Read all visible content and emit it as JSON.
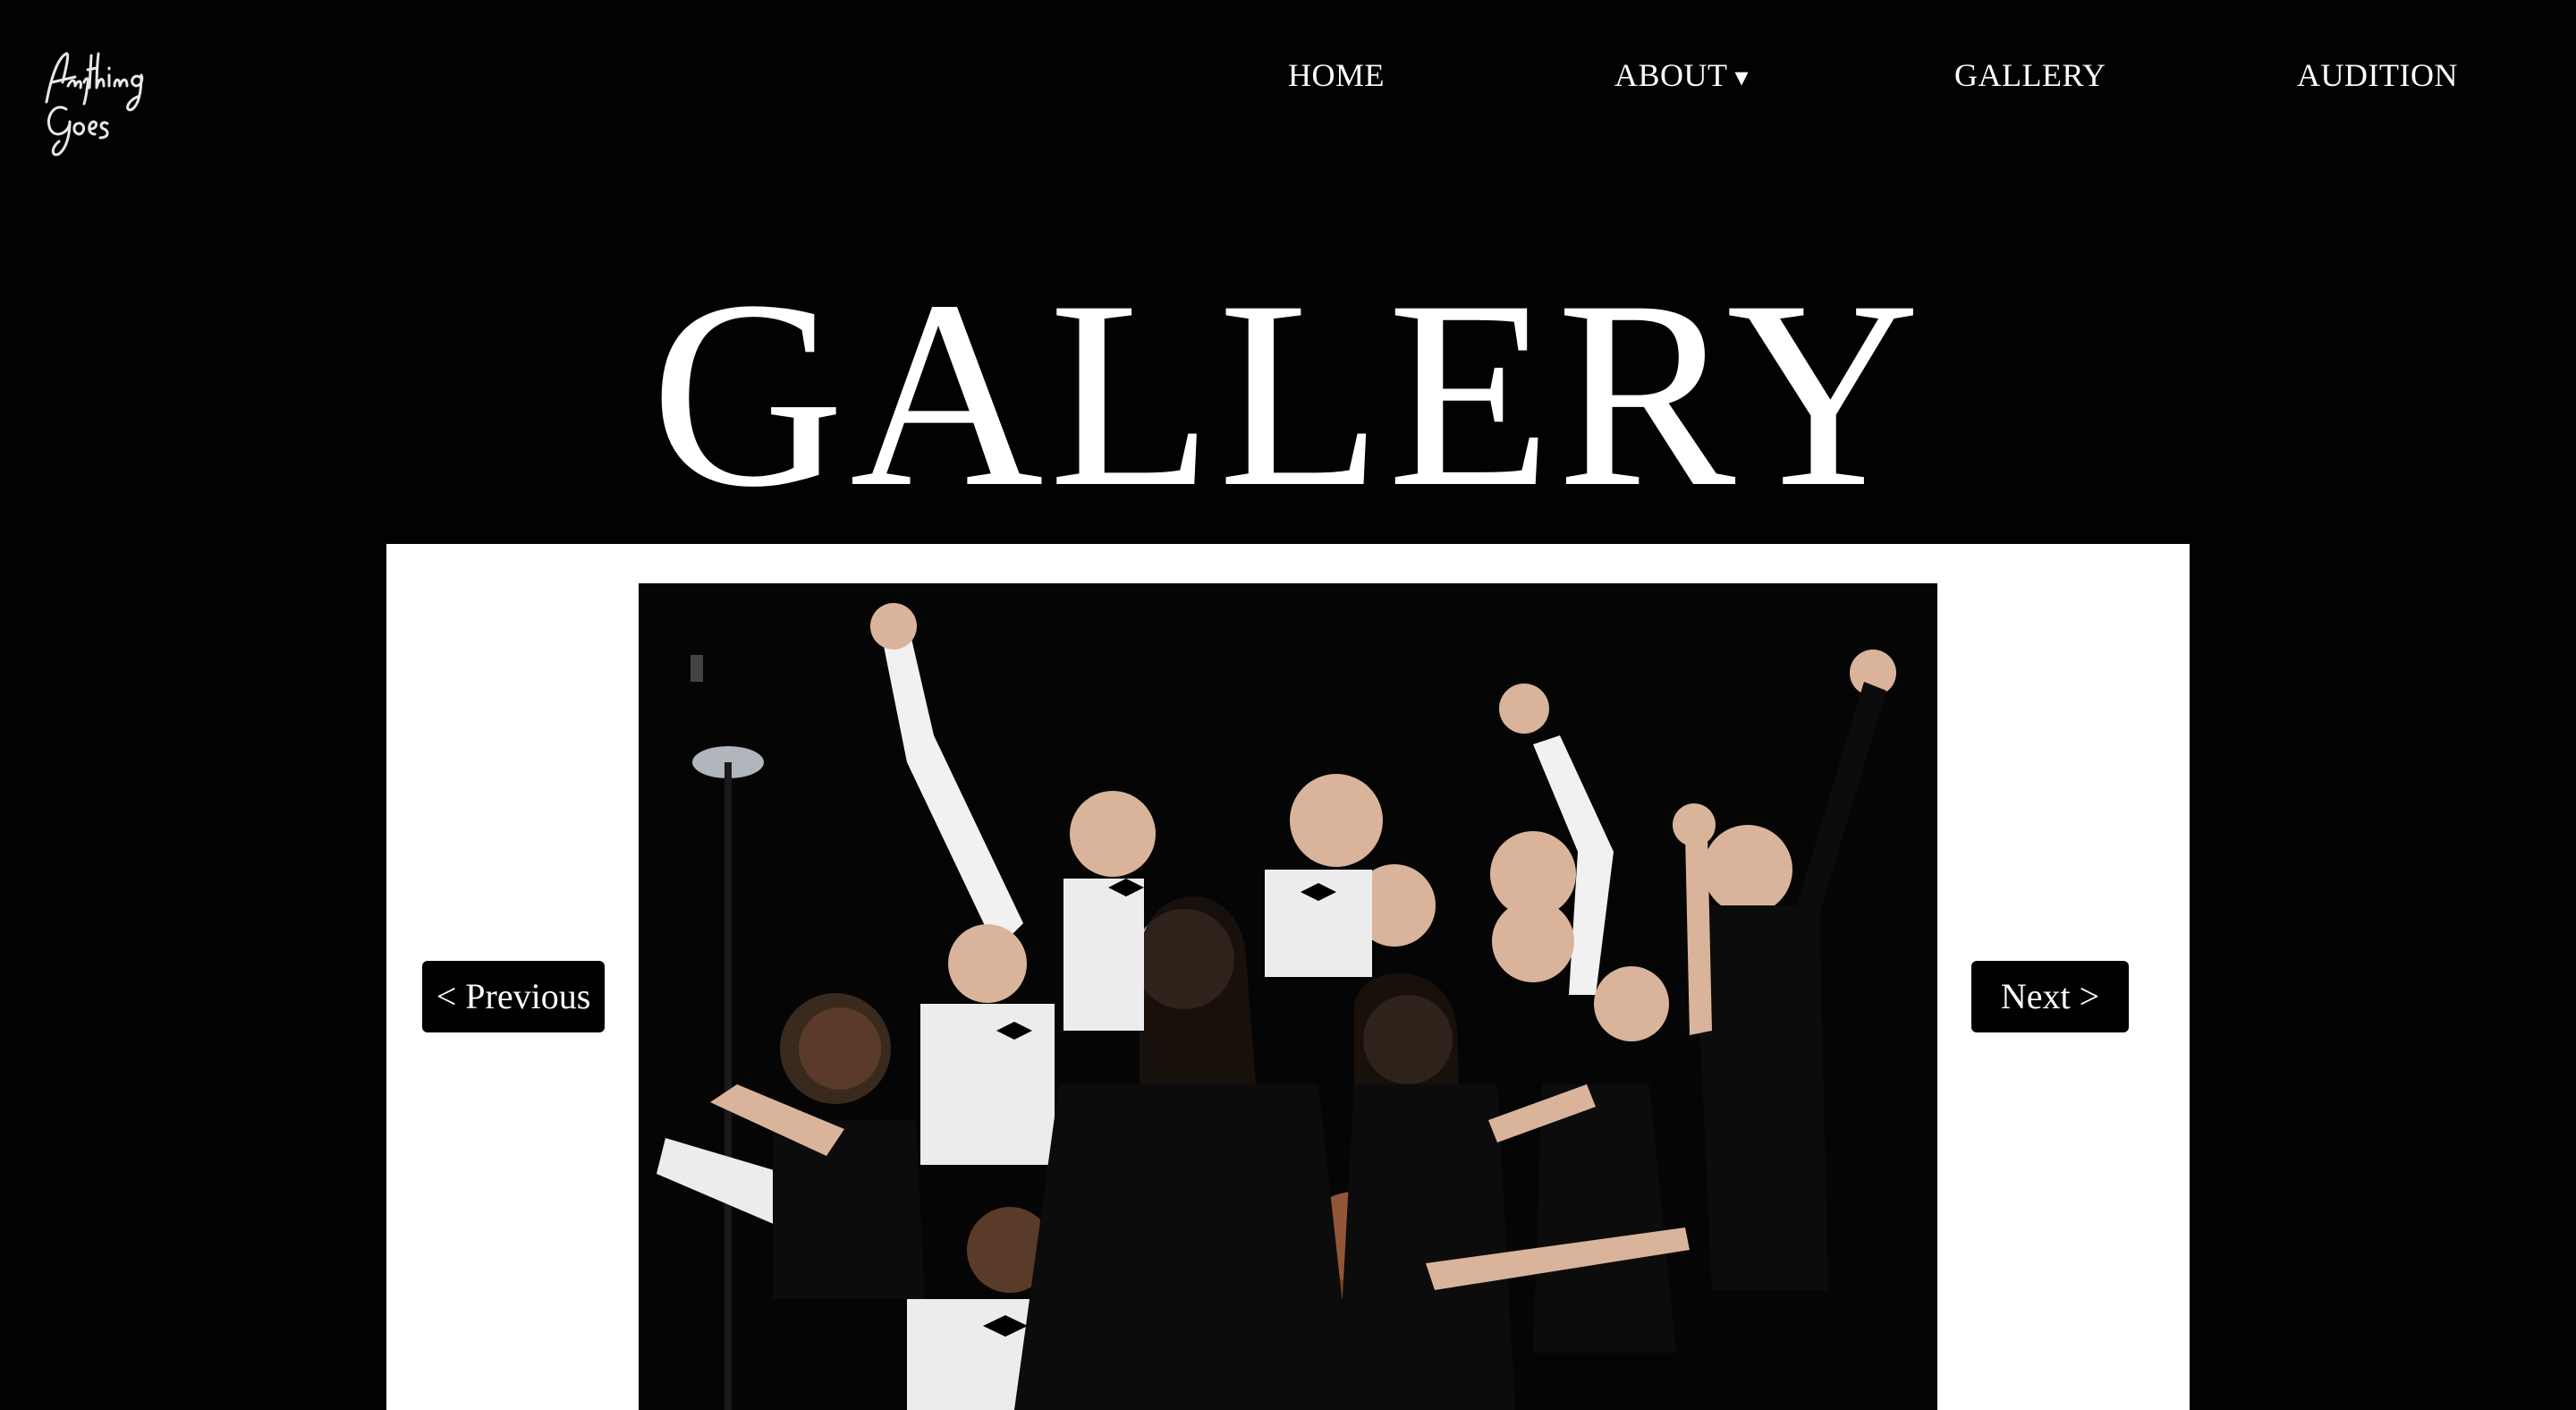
{
  "header": {
    "logo_text": "Anything Goes",
    "nav": {
      "home": "HOME",
      "about": "ABOUT",
      "about_caret": "▾",
      "gallery": "GALLERY",
      "audition": "AUDITION"
    }
  },
  "main": {
    "title": "GALLERY",
    "slideshow": {
      "prev_label": "< Previous",
      "next_label": "Next >",
      "image_icon": "group-photo"
    }
  },
  "colors": {
    "background": "#020203",
    "text": "#ffffff",
    "slideshow_bg": "#ffffff",
    "button_bg": "#000000"
  }
}
